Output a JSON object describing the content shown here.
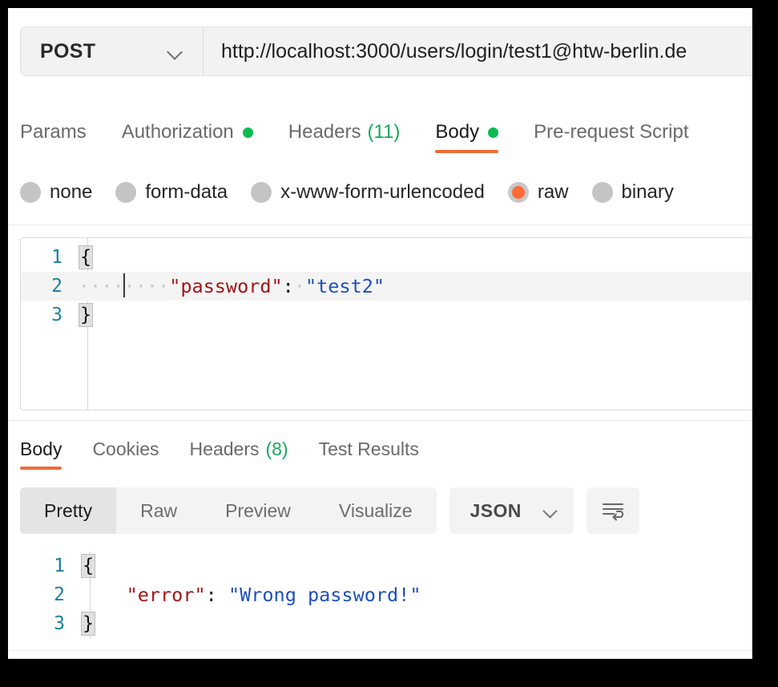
{
  "request": {
    "method": "POST",
    "url": "http://localhost:3000/users/login/test1@htw-berlin.de",
    "tabs": [
      {
        "label": "Params",
        "active": false,
        "dot": false,
        "count": ""
      },
      {
        "label": "Authorization",
        "active": false,
        "dot": true,
        "count": ""
      },
      {
        "label": "Headers",
        "active": false,
        "dot": false,
        "count": "(11)"
      },
      {
        "label": "Body",
        "active": true,
        "dot": true,
        "count": ""
      },
      {
        "label": "Pre-request Script",
        "active": false,
        "dot": false,
        "count": ""
      }
    ],
    "body_types": [
      {
        "label": "none",
        "selected": false
      },
      {
        "label": "form-data",
        "selected": false
      },
      {
        "label": "x-www-form-urlencoded",
        "selected": false
      },
      {
        "label": "raw",
        "selected": true
      },
      {
        "label": "binary",
        "selected": false
      }
    ],
    "editor": {
      "line1_num": "1",
      "line1_text": "{",
      "line2_num": "2",
      "line2_indent_a": "····",
      "line2_indent_b": "····",
      "line2_key": "\"password\"",
      "line2_colon": ":",
      "line2_space": "·",
      "line2_value": "\"test2\"",
      "line3_num": "3",
      "line3_text": "}"
    }
  },
  "response": {
    "tabs": [
      {
        "label": "Body",
        "active": true,
        "count": ""
      },
      {
        "label": "Cookies",
        "active": false,
        "count": ""
      },
      {
        "label": "Headers",
        "active": false,
        "count": "(8)"
      },
      {
        "label": "Test Results",
        "active": false,
        "count": ""
      }
    ],
    "view_modes": [
      {
        "label": "Pretty",
        "active": true
      },
      {
        "label": "Raw",
        "active": false
      },
      {
        "label": "Preview",
        "active": false
      },
      {
        "label": "Visualize",
        "active": false
      }
    ],
    "format": "JSON",
    "wrap_icon": "word-wrap-icon",
    "body": {
      "line1_num": "1",
      "line1_text": "{",
      "line2_num": "2",
      "line2_indent": "    ",
      "line2_key": "\"error\"",
      "line2_colon": ":",
      "line2_space": " ",
      "line2_value": "\"Wrong password!\"",
      "line3_num": "3",
      "line3_text": "}"
    }
  },
  "colors": {
    "accent": "#ef6c37",
    "radio_selected": "#ff6c37",
    "status_dot": "#0cbb52",
    "count_green": "#18a95b",
    "json_key": "#a31515",
    "json_string": "#1d4fbe",
    "line_number": "#1b7fa0"
  }
}
